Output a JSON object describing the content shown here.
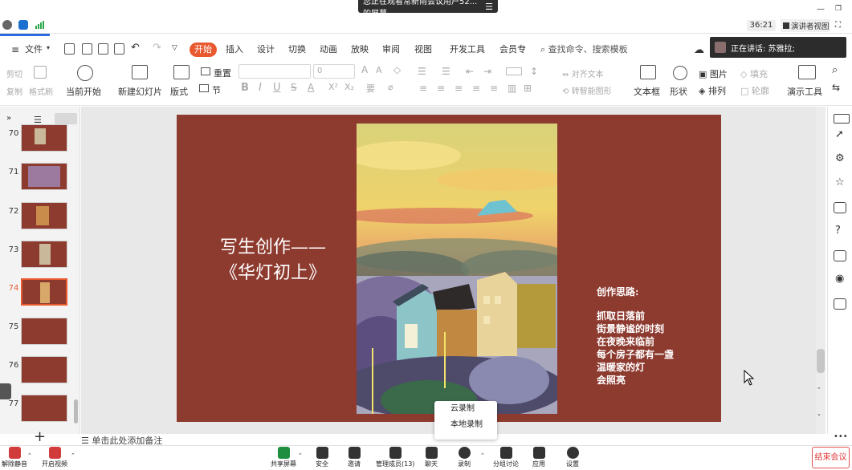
{
  "meeting": {
    "share_banner": "您正在观看常新雨会议用户52...的屏幕",
    "timer": "36:21",
    "view_mode": "演讲者视图",
    "speaking": "正在讲话: 苏雅拉;"
  },
  "wps": {
    "file_menu": "文件",
    "tabs": [
      "开始",
      "插入",
      "设计",
      "切换",
      "动画",
      "放映",
      "审阅",
      "视图",
      "开发工具",
      "会员专"
    ],
    "search_placeholder": "查找命令、搜索模板",
    "ribbon": {
      "clip_labels": [
        "剪切",
        "复制",
        "格式刷"
      ],
      "start_show": "当前开始",
      "new_slide": "新建幻灯片",
      "layout": "版式",
      "section": "节",
      "reset": "重置",
      "font_size": "0",
      "text_dir": "文字方向",
      "align_text": "对齐文本",
      "smartart": "转智能图形",
      "textbox": "文本框",
      "shape": "形状",
      "picture": "图片",
      "arrange": "排列",
      "fill": "填充",
      "outline": "轮廓",
      "present_tools": "演示工具"
    }
  },
  "thumbnails": [
    {
      "num": "70",
      "selected": false
    },
    {
      "num": "71",
      "selected": false
    },
    {
      "num": "72",
      "selected": false
    },
    {
      "num": "73",
      "selected": false
    },
    {
      "num": "74",
      "selected": true
    },
    {
      "num": "75",
      "selected": false
    },
    {
      "num": "76",
      "selected": false
    },
    {
      "num": "77",
      "selected": false
    }
  ],
  "slide": {
    "title_line1": "写生创作——",
    "title_line2": "《华灯初上》",
    "notes_head": "创作思路:",
    "notes_lines": [
      "抓取日落前",
      "街景静谧的时刻",
      "在夜晚来临前",
      "每个房子都有一盏",
      "温暖家的灯",
      "会照亮"
    ],
    "bg_color": "#8d3a2f"
  },
  "notes_bar": "单击此处添加备注",
  "bottom_toolbar": {
    "items": [
      "解除静音",
      "开启视频",
      "共享屏幕",
      "安全",
      "邀请",
      "管理成员(13)",
      "聊天",
      "录制",
      "分组讨论",
      "应用",
      "设置"
    ],
    "end_meeting": "结束会议"
  },
  "record_popup": [
    "云录制",
    "本地录制"
  ]
}
